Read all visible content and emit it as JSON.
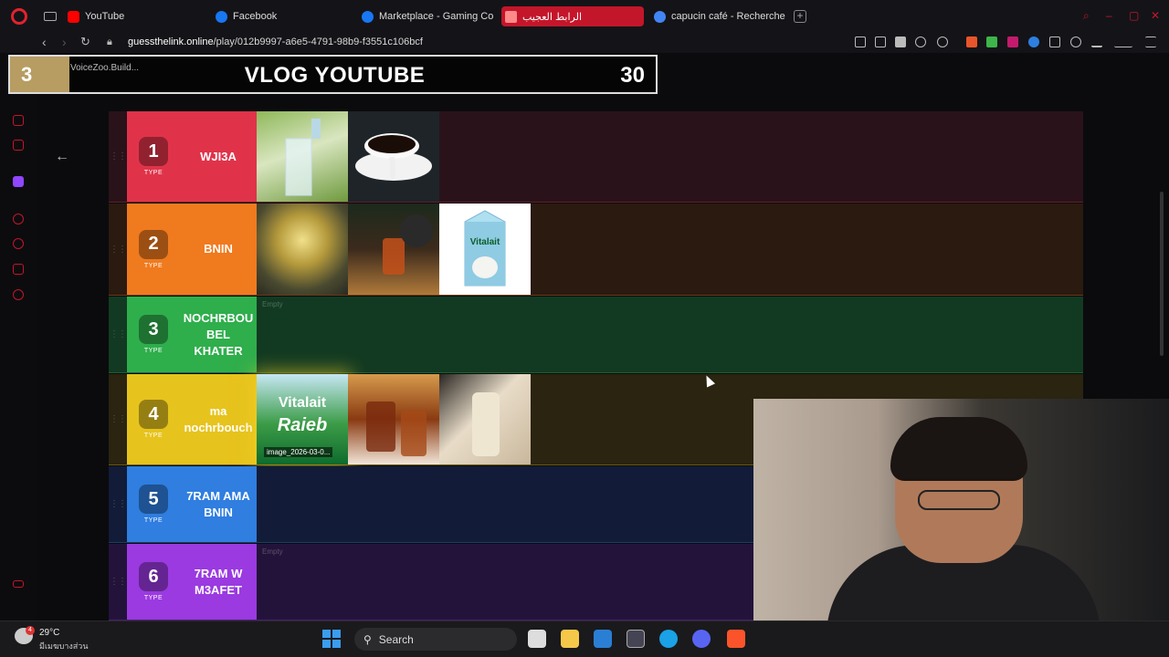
{
  "browser": {
    "tabs": [
      {
        "label": "YouTube",
        "color": "#ff0000"
      },
      {
        "label": "Facebook",
        "color": "#1877f2"
      },
      {
        "label": "Marketplace - Gaming Co",
        "color": "#1877f2"
      },
      {
        "label": "الرابط العجيب",
        "color": "#ff5a5a"
      },
      {
        "label": "capucin café - Recherche",
        "color": "#4285f4"
      }
    ],
    "url_host": "guessthelink.online",
    "url_path": "/play/012b9997-a6e5-4791-98b9-f3551c106bcf"
  },
  "overlay": {
    "number": "3",
    "subtitle": "VoiceZoo.Build...",
    "title": "VLOG YOUTUBE",
    "count": "30"
  },
  "tiers": [
    {
      "rank": "1",
      "type": "TYPE",
      "label": "WJI3A",
      "color": "#e0334a",
      "bg": "#2a121a",
      "items": [
        "water-glass",
        "coffee-cup"
      ],
      "empty": ""
    },
    {
      "rank": "2",
      "type": "TYPE",
      "label": "BNIN",
      "color": "#f07a1e",
      "bg": "#2a1a10",
      "items": [
        "green-tea",
        "black-tea",
        "vitalait-milk"
      ],
      "empty": ""
    },
    {
      "rank": "3",
      "type": "TYPE",
      "label": "NOCHRBOU BEL KHATER",
      "color": "#2fae4c",
      "bg": "#123a22",
      "items": [],
      "empty": "Empty"
    },
    {
      "rank": "4",
      "type": "TYPE",
      "label": "ma nochrbouch",
      "color": "#e7c31d",
      "bg": "#2a2410",
      "items": [
        "vitalait-raieb",
        "iced-tea",
        "milkshake"
      ],
      "empty": "",
      "caption": "image_2026-03-0..."
    },
    {
      "rank": "5",
      "type": "TYPE",
      "label": "7RAM AMA BNIN",
      "color": "#2f7ee0",
      "bg": "#121c38",
      "items": [],
      "empty": ""
    },
    {
      "rank": "6",
      "type": "TYPE",
      "label": "7RAM W M3AFET",
      "color": "#9a3ae0",
      "bg": "#23133a",
      "items": [],
      "empty": "Empty"
    }
  ],
  "item_text": {
    "vitalait": "Vitalait",
    "raieb": "Raieb"
  },
  "taskbar": {
    "temperature": "29°C",
    "weather_desc": "มีเมฆบางส่วน",
    "weather_badge": "4",
    "search_label": "Search"
  }
}
